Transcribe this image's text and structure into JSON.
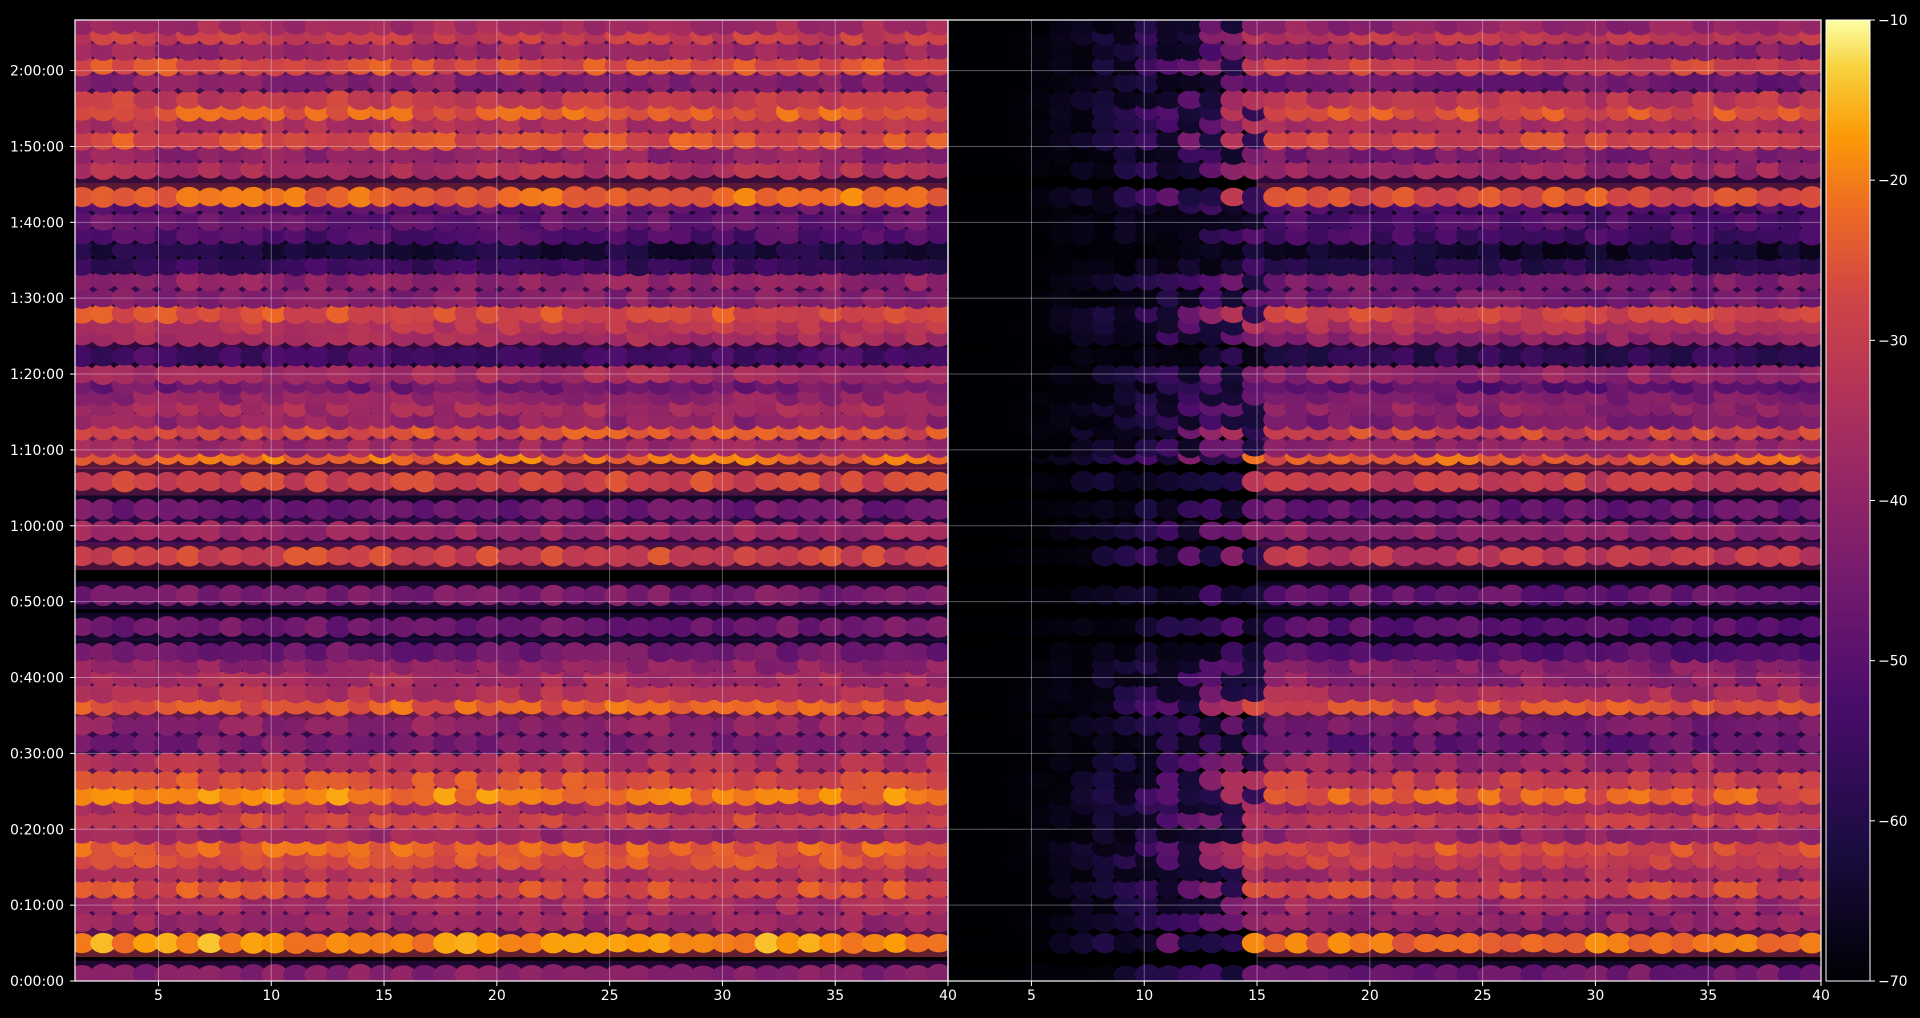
{
  "chart_data": {
    "type": "heatmap",
    "title": "",
    "xlabel": "",
    "ylabel": "",
    "grid": true,
    "panels": [
      {
        "name": "left-panel",
        "xlim": [
          1.3,
          40
        ],
        "ylim": [
          0,
          7600
        ]
      },
      {
        "name": "right-panel",
        "xlim": [
          1.3,
          40
        ],
        "ylim": [
          0,
          7600
        ]
      }
    ],
    "x_ticks": [
      5,
      10,
      15,
      20,
      25,
      30,
      35,
      40
    ],
    "x_tick_labels": [
      "5",
      "10",
      "15",
      "20",
      "25",
      "30",
      "35",
      "40"
    ],
    "y_ticks": [
      0,
      600,
      1200,
      1800,
      2400,
      3000,
      3600,
      4200,
      4800,
      5400,
      6000,
      6600,
      7200
    ],
    "y_tick_labels": [
      "0:00:00",
      "0:10:00",
      "0:20:00",
      "0:30:00",
      "0:40:00",
      "0:50:00",
      "1:00:00",
      "1:10:00",
      "1:20:00",
      "1:30:00",
      "1:40:00",
      "1:50:00",
      "2:00:00"
    ],
    "colormap": "inferno",
    "colorbar": {
      "range": [
        -70,
        -10
      ],
      "ticks": [
        -70,
        -60,
        -50,
        -40,
        -30,
        -20,
        -10
      ],
      "tick_labels": [
        "−70",
        "−60",
        "−50",
        "−40",
        "−30",
        "−20",
        "−10"
      ]
    },
    "row_times_seconds": [
      50,
      300,
      470,
      600,
      730,
      860,
      960,
      1060,
      1160,
      1280,
      1390,
      1470,
      1590,
      1730,
      1880,
      2020,
      2180,
      2280,
      2400,
      2500,
      2600,
      2800,
      3050,
      3360,
      3560,
      3730,
      3950,
      4160,
      4220,
      4360,
      4440,
      4540,
      4630,
      4720,
      4800,
      4940,
      5100,
      5190,
      5280,
      5400,
      5540,
      5660,
      5780,
      5900,
      6010,
      6140,
      6200,
      6420,
      6540,
      6650,
      6780,
      6880,
      6970,
      7110,
      7240,
      7360,
      7480,
      7560
    ],
    "row_values_left_dB": [
      -42,
      -18,
      -38,
      -36,
      -26,
      -34,
      -26,
      -24,
      -38,
      -28,
      -36,
      -20,
      -26,
      -34,
      -44,
      -40,
      -24,
      -34,
      -36,
      -40,
      -46,
      -46,
      -44,
      -28,
      -38,
      -46,
      -28,
      -22,
      -38,
      -26,
      -40,
      -36,
      -40,
      -46,
      -36,
      -54,
      -36,
      -32,
      -26,
      -42,
      -40,
      -56,
      -62,
      -52,
      -48,
      -48,
      -22,
      -34,
      -40,
      -26,
      -34,
      -24,
      -30,
      -42,
      -26,
      -38,
      -30,
      -36
    ],
    "row_values_right_dB": [
      -46,
      -22,
      -40,
      -38,
      -28,
      -36,
      -30,
      -26,
      -40,
      -30,
      -38,
      -24,
      -30,
      -38,
      -48,
      -44,
      -26,
      -36,
      -40,
      -42,
      -50,
      -50,
      -48,
      -32,
      -40,
      -48,
      -30,
      -24,
      -40,
      -28,
      -44,
      -40,
      -44,
      -50,
      -40,
      -58,
      -40,
      -34,
      -28,
      -46,
      -44,
      -58,
      -64,
      -54,
      -52,
      -52,
      -26,
      -38,
      -44,
      -28,
      -36,
      -26,
      -32,
      -46,
      -28,
      -42,
      -32,
      -40
    ],
    "right_panel_note_onset_x": 15
  }
}
